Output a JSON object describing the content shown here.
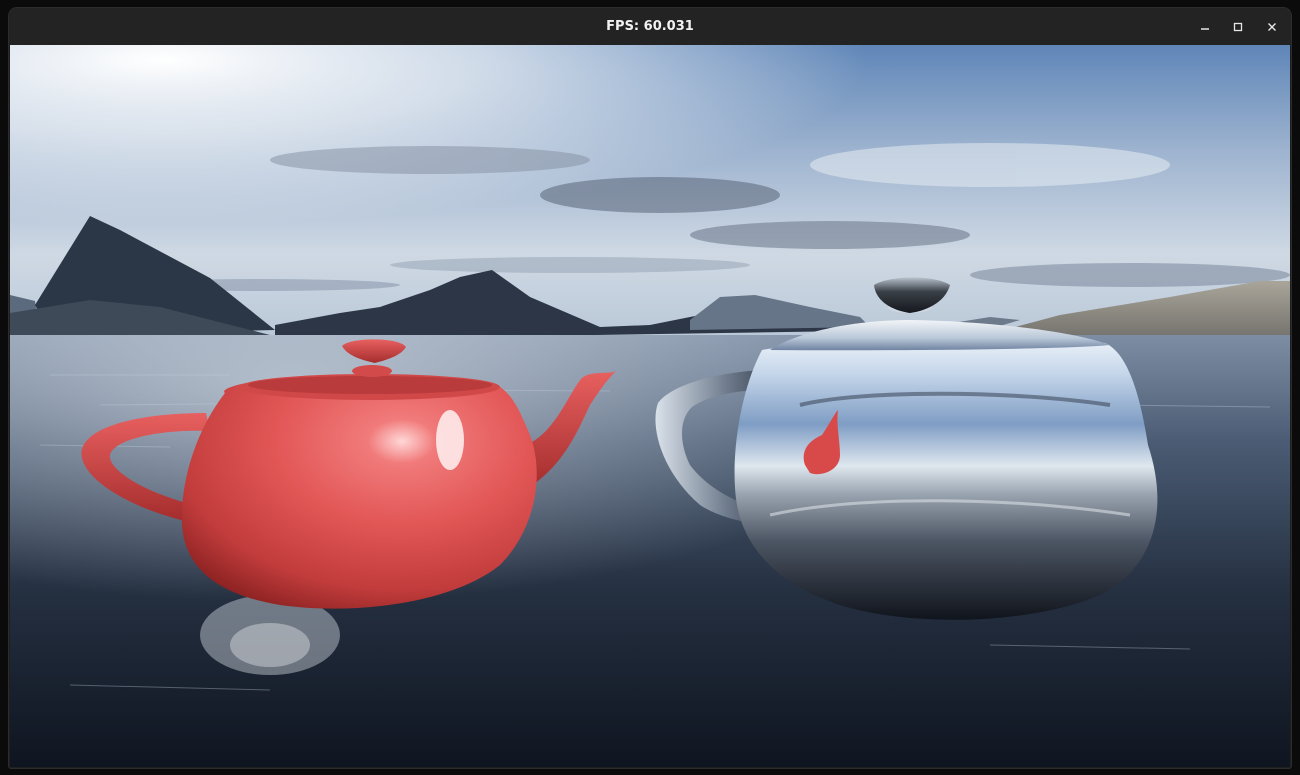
{
  "window": {
    "title": "FPS: 60.031",
    "controls": {
      "minimize_icon": "minimize-icon",
      "maximize_icon": "maximize-icon",
      "close_icon": "close-icon"
    }
  },
  "scene": {
    "description_icons": [
      "sky-skybox",
      "mountains",
      "water-plane",
      "red-teapot",
      "chrome-teapot"
    ],
    "colors": {
      "sky_top": "#5b84b8",
      "sky_horizon": "#d8e2ec",
      "water_far": "#5a6d86",
      "water_near": "#141b28",
      "red_teapot": "#e25656",
      "chrome_teapot": "#a7b7cc"
    }
  }
}
